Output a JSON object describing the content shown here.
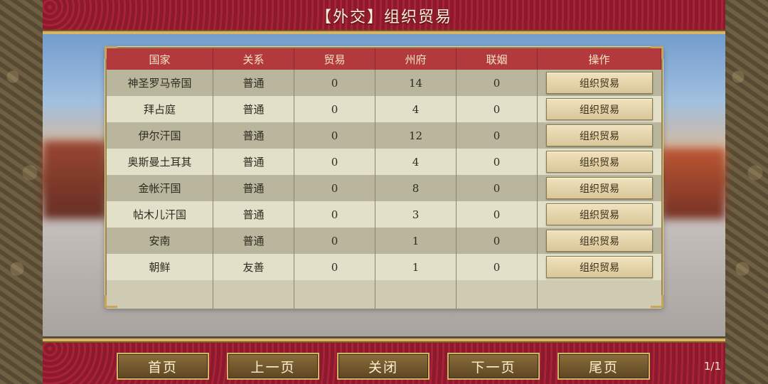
{
  "title": "【外交】组织贸易",
  "table": {
    "headers": [
      "国家",
      "关系",
      "贸易",
      "州府",
      "联姻",
      "操作"
    ],
    "rows": [
      {
        "country": "神圣罗马帝国",
        "relation": "普通",
        "trade": "0",
        "provinces": "14",
        "marriage": "0",
        "action": "组织贸易"
      },
      {
        "country": "拜占庭",
        "relation": "普通",
        "trade": "0",
        "provinces": "4",
        "marriage": "0",
        "action": "组织贸易"
      },
      {
        "country": "伊尔汗国",
        "relation": "普通",
        "trade": "0",
        "provinces": "12",
        "marriage": "0",
        "action": "组织贸易"
      },
      {
        "country": "奥斯曼土耳其",
        "relation": "普通",
        "trade": "0",
        "provinces": "4",
        "marriage": "0",
        "action": "组织贸易"
      },
      {
        "country": "金帐汗国",
        "relation": "普通",
        "trade": "0",
        "provinces": "8",
        "marriage": "0",
        "action": "组织贸易"
      },
      {
        "country": "帖木儿汗国",
        "relation": "普通",
        "trade": "0",
        "provinces": "3",
        "marriage": "0",
        "action": "组织贸易"
      },
      {
        "country": "安南",
        "relation": "普通",
        "trade": "0",
        "provinces": "1",
        "marriage": "0",
        "action": "组织贸易"
      },
      {
        "country": "朝鲜",
        "relation": "友善",
        "trade": "0",
        "provinces": "1",
        "marriage": "0",
        "action": "组织贸易"
      }
    ]
  },
  "nav": {
    "first": "首页",
    "prev": "上一页",
    "close": "关闭",
    "next": "下一页",
    "last": "尾页"
  },
  "page_indicator": "1/1",
  "colors": {
    "header_red": "#b33a3c",
    "frame_gold": "#d8b565",
    "banner_red": "#8c1a2c"
  }
}
